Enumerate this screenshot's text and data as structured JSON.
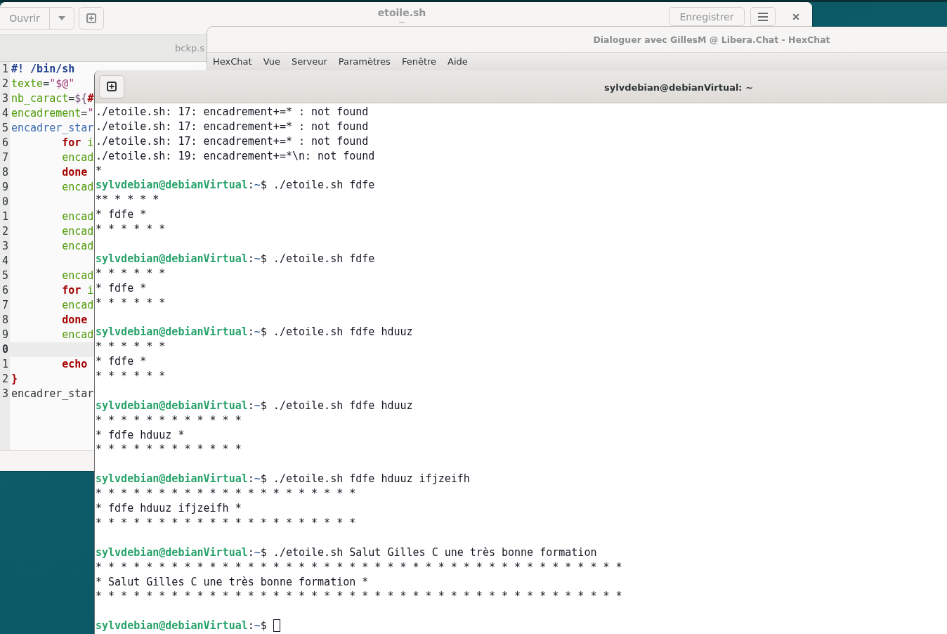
{
  "editor": {
    "open_button": "Ouvrir",
    "title": "etoile.sh",
    "subtitle": "~",
    "save_button": "Enregistrer",
    "tabs": [
      {
        "label": "bckp.s",
        "selected": false
      }
    ],
    "lines": [
      {
        "number": "1",
        "current": false,
        "tokens": [
          {
            "kind": "comment",
            "text": "#! /bin/sh"
          }
        ]
      },
      {
        "number": "2",
        "current": false,
        "tokens": [
          {
            "kind": "variable",
            "text": "texte"
          },
          {
            "kind": "operator",
            "text": "="
          },
          {
            "kind": "string",
            "text": "\"$@\""
          }
        ]
      },
      {
        "number": "3",
        "current": false,
        "tokens": [
          {
            "kind": "variable",
            "text": "nb_caract"
          },
          {
            "kind": "operator",
            "text": "="
          },
          {
            "kind": "expansion",
            "text": "${"
          },
          {
            "kind": "keyword",
            "text": "#"
          }
        ]
      },
      {
        "number": "4",
        "current": false,
        "tokens": [
          {
            "kind": "variable",
            "text": "encadrement"
          },
          {
            "kind": "operator",
            "text": "="
          },
          {
            "kind": "string",
            "text": "\""
          }
        ]
      },
      {
        "number": "5",
        "current": false,
        "tokens": [
          {
            "kind": "function",
            "text": "encadrer_star"
          }
        ]
      },
      {
        "number": "6",
        "current": false,
        "tokens": [
          {
            "kind": "keyword",
            "text": "        for"
          },
          {
            "kind": "variable",
            "text": " i"
          }
        ]
      },
      {
        "number": "7",
        "current": false,
        "tokens": [
          {
            "kind": "variable",
            "text": "        encad"
          }
        ]
      },
      {
        "number": "8",
        "current": false,
        "tokens": [
          {
            "kind": "keyword",
            "text": "        done"
          }
        ]
      },
      {
        "number": "9",
        "current": false,
        "tokens": [
          {
            "kind": "variable",
            "text": "        encad"
          }
        ]
      },
      {
        "number": "0",
        "current": false
      },
      {
        "number": "1",
        "current": false,
        "tokens": [
          {
            "kind": "variable",
            "text": "        encad"
          }
        ]
      },
      {
        "number": "2",
        "current": false,
        "tokens": [
          {
            "kind": "variable",
            "text": "        encad"
          }
        ]
      },
      {
        "number": "3",
        "current": false,
        "tokens": [
          {
            "kind": "variable",
            "text": "        encad"
          }
        ]
      },
      {
        "number": "4",
        "current": false
      },
      {
        "number": "5",
        "current": false,
        "tokens": [
          {
            "kind": "variable",
            "text": "        encad"
          }
        ]
      },
      {
        "number": "6",
        "current": false,
        "tokens": [
          {
            "kind": "keyword",
            "text": "        for"
          },
          {
            "kind": "variable",
            "text": " i"
          }
        ]
      },
      {
        "number": "7",
        "current": false,
        "tokens": [
          {
            "kind": "variable",
            "text": "        encad"
          }
        ]
      },
      {
        "number": "8",
        "current": false,
        "tokens": [
          {
            "kind": "keyword",
            "text": "        done"
          }
        ]
      },
      {
        "number": "9",
        "current": false,
        "tokens": [
          {
            "kind": "variable",
            "text": "        encad"
          }
        ]
      },
      {
        "number": "0",
        "current": true
      },
      {
        "number": "1",
        "current": false,
        "tokens": [
          {
            "kind": "keyword",
            "text": "        echo"
          }
        ]
      },
      {
        "number": "2",
        "current": false,
        "tokens": [
          {
            "kind": "keyword",
            "text": "}"
          }
        ]
      },
      {
        "number": "3",
        "current": false,
        "tokens": [
          {
            "kind": "plain",
            "text": "encadrer_star"
          }
        ]
      }
    ]
  },
  "chat": {
    "title": "Dialoguer avec GillesM @ Libera.Chat - HexChat",
    "menu": [
      "HexChat",
      "Vue",
      "Serveur",
      "Paramètres",
      "Fenêtre",
      "Aide"
    ]
  },
  "terminal": {
    "title": "sylvdebian@debianVirtual: ~",
    "lines": [
      {
        "kind": "output",
        "text": "./etoile.sh: 17: encadrement+=* : not found"
      },
      {
        "kind": "output",
        "text": "./etoile.sh: 17: encadrement+=* : not found"
      },
      {
        "kind": "output",
        "text": "./etoile.sh: 17: encadrement+=* : not found"
      },
      {
        "kind": "output",
        "text": "./etoile.sh: 19: encadrement+=*\\n: not found"
      },
      {
        "kind": "output",
        "text": "*"
      },
      {
        "kind": "prompt",
        "user": "sylvdebian@debianVirtual",
        "separator": ":",
        "cwd": "~",
        "sign": "$",
        "command": "./etoile.sh fdfe",
        "cursor": false
      },
      {
        "kind": "output",
        "text": "** * * * *"
      },
      {
        "kind": "output",
        "text": "* fdfe *"
      },
      {
        "kind": "output",
        "text": "* * * * * *"
      },
      {
        "kind": "blank"
      },
      {
        "kind": "prompt",
        "user": "sylvdebian@debianVirtual",
        "separator": ":",
        "cwd": "~",
        "sign": "$",
        "command": "./etoile.sh fdfe",
        "cursor": false
      },
      {
        "kind": "output",
        "text": "* * * * * *"
      },
      {
        "kind": "output",
        "text": "* fdfe *"
      },
      {
        "kind": "output",
        "text": "* * * * * *"
      },
      {
        "kind": "blank"
      },
      {
        "kind": "prompt",
        "user": "sylvdebian@debianVirtual",
        "separator": ":",
        "cwd": "~",
        "sign": "$",
        "command": "./etoile.sh fdfe hduuz",
        "cursor": false
      },
      {
        "kind": "output",
        "text": "* * * * * *"
      },
      {
        "kind": "output",
        "text": "* fdfe *"
      },
      {
        "kind": "output",
        "text": "* * * * * *"
      },
      {
        "kind": "blank"
      },
      {
        "kind": "prompt",
        "user": "sylvdebian@debianVirtual",
        "separator": ":",
        "cwd": "~",
        "sign": "$",
        "command": "./etoile.sh fdfe hduuz",
        "cursor": false
      },
      {
        "kind": "output",
        "text": "* * * * * * * * * * * *"
      },
      {
        "kind": "output",
        "text": "* fdfe hduuz *"
      },
      {
        "kind": "output",
        "text": "* * * * * * * * * * * *"
      },
      {
        "kind": "blank"
      },
      {
        "kind": "prompt",
        "user": "sylvdebian@debianVirtual",
        "separator": ":",
        "cwd": "~",
        "sign": "$",
        "command": "./etoile.sh fdfe hduuz ifjzeifh",
        "cursor": false
      },
      {
        "kind": "output",
        "text": "* * * * * * * * * * * * * * * * * * * * *"
      },
      {
        "kind": "output",
        "text": "* fdfe hduuz ifjzeifh *"
      },
      {
        "kind": "output",
        "text": "* * * * * * * * * * * * * * * * * * * * *"
      },
      {
        "kind": "blank"
      },
      {
        "kind": "prompt",
        "user": "sylvdebian@debianVirtual",
        "separator": ":",
        "cwd": "~",
        "sign": "$",
        "command": "./etoile.sh Salut Gilles C une très bonne formation",
        "cursor": false
      },
      {
        "kind": "output",
        "text": "* * * * * * * * * * * * * * * * * * * * * * * * * * * * * * * * * * * * * * * * * *"
      },
      {
        "kind": "output",
        "text": "* Salut Gilles C une très bonne formation *"
      },
      {
        "kind": "output",
        "text": "* * * * * * * * * * * * * * * * * * * * * * * * * * * * * * * * * * * * * * * * * *"
      },
      {
        "kind": "blank"
      },
      {
        "kind": "prompt",
        "user": "sylvdebian@debianVirtual",
        "separator": ":",
        "cwd": "~",
        "sign": "$",
        "cursor": true
      }
    ]
  }
}
